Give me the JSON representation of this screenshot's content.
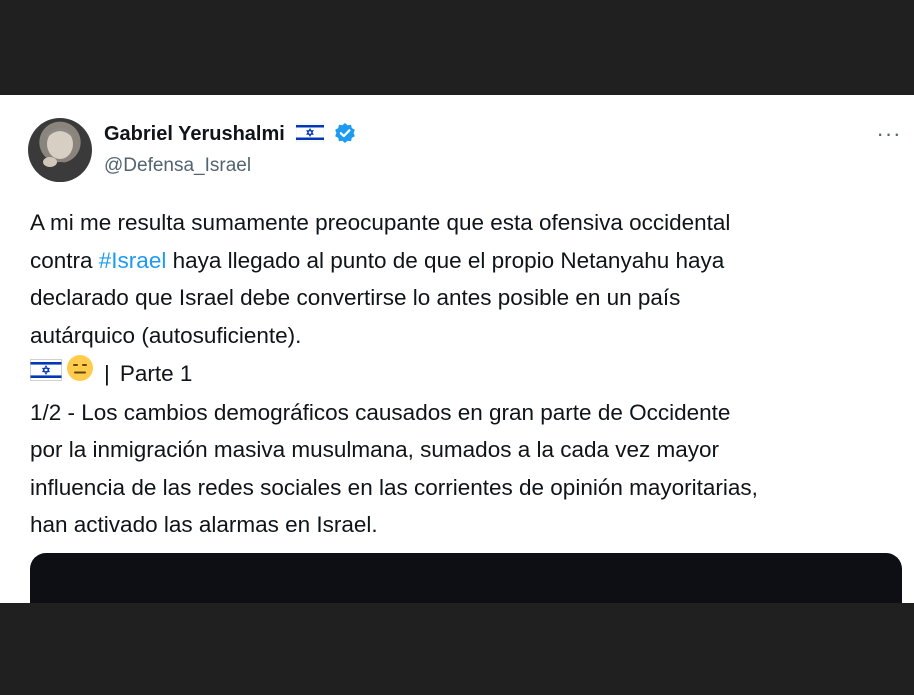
{
  "author": {
    "name": "Gabriel Yerushalmi",
    "flag_icon": "israel-flag-icon",
    "verified_icon": "verified-badge-icon",
    "handle": "@Defensa_Israel"
  },
  "menu": {
    "more_label": "···"
  },
  "post": {
    "line1": "A mi me resulta sumamente preocupante que esta ofensiva occidental",
    "line2_prefix": "contra ",
    "line2_hashtag": "#Israel",
    "line2_suffix": " haya llegado al punto de que el propio Netanyahu haya",
    "line3": "declarado que Israel debe convertirse lo antes posible en un país",
    "line4": "autárquico (autosuficiente).",
    "emoji_line_sep": "|",
    "emoji_line_text": "Parte 1",
    "line6": "1/2 - Los cambios demográficos causados en gran parte de Occidente",
    "line7": "por la inmigración masiva musulmana, sumados a la cada vez mayor",
    "line8": "influencia de las redes sociales en las corrientes de opinión mayoritarias,",
    "line9": "han activado las alarmas en Israel."
  },
  "colors": {
    "link": "#1d9bf0",
    "verified": "#1d9bf0",
    "text": "#0f1419",
    "muted": "#536471",
    "letterbox": "#202020"
  }
}
